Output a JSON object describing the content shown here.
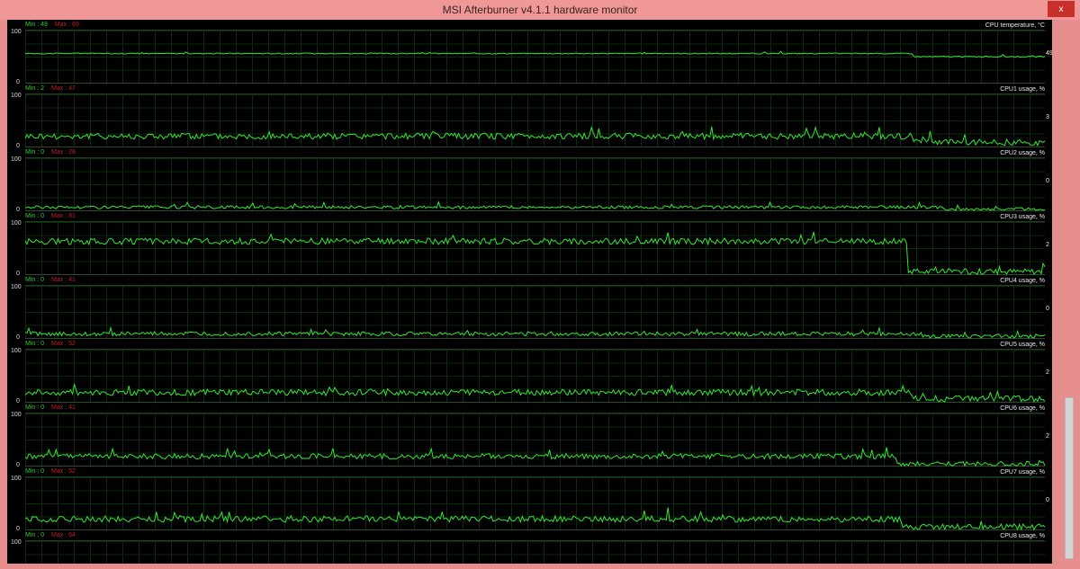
{
  "window": {
    "title": "MSI Afterburner v4.1.1 hardware monitor",
    "close_label": "x"
  },
  "axis": {
    "y_max": "100",
    "y_min": "0"
  },
  "colors": {
    "line": "#33e833",
    "min": "#2fcf2f",
    "max": "#c02020",
    "background": "#000000",
    "frame": "#e68e8e"
  },
  "graphs": [
    {
      "name": "CPU temperature, °C",
      "min_text": "Min : 49",
      "max_text": "Max : 69",
      "current": "49"
    },
    {
      "name": "CPU1 usage, %",
      "min_text": "Min : 2",
      "max_text": "Max : 47",
      "current": "3"
    },
    {
      "name": "CPU2 usage, %",
      "min_text": "Min : 0",
      "max_text": "Max : 28",
      "current": "0"
    },
    {
      "name": "CPU3 usage, %",
      "min_text": "Min : 0",
      "max_text": "Max : 81",
      "current": "2"
    },
    {
      "name": "CPU4 usage, %",
      "min_text": "Min : 0",
      "max_text": "Max : 41",
      "current": "0"
    },
    {
      "name": "CPU5 usage, %",
      "min_text": "Min : 0",
      "max_text": "Max : 52",
      "current": "2"
    },
    {
      "name": "CPU6 usage, %",
      "min_text": "Min : 0",
      "max_text": "Max : 41",
      "current": "2"
    },
    {
      "name": "CPU7 usage, %",
      "min_text": "Min : 0",
      "max_text": "Max : 52",
      "current": "0"
    },
    {
      "name": "CPU8 usage, %",
      "min_text": "Min : 0",
      "max_text": "Max : 64",
      "current": ""
    }
  ],
  "chart_data": {
    "type": "line",
    "ylim": [
      0,
      100
    ],
    "series": [
      {
        "name": "CPU temperature, °C",
        "level": 56,
        "noise": 1,
        "drop_at": 0.87,
        "after": 50
      },
      {
        "name": "CPU1 usage, %",
        "level": 20,
        "noise": 6,
        "drop_at": 0.87,
        "after": 8
      },
      {
        "name": "CPU2 usage, %",
        "level": 6,
        "noise": 3,
        "drop_at": 0.9,
        "after": 2
      },
      {
        "name": "CPU3 usage, %",
        "level": 63,
        "noise": 6,
        "drop_at": 0.865,
        "after": 5
      },
      {
        "name": "CPU4 usage, %",
        "level": 8,
        "noise": 4,
        "drop_at": 0.88,
        "after": 3
      },
      {
        "name": "CPU5 usage, %",
        "level": 18,
        "noise": 6,
        "drop_at": 0.87,
        "after": 6
      },
      {
        "name": "CPU6 usage, %",
        "level": 18,
        "noise": 5,
        "drop_at": 0.855,
        "after": 3
      },
      {
        "name": "CPU7 usage, %",
        "level": 20,
        "noise": 6,
        "drop_at": 0.86,
        "after": 5
      },
      {
        "name": "CPU8 usage, %",
        "level": 20,
        "noise": 6,
        "drop_at": 0.86,
        "after": 5
      }
    ]
  }
}
